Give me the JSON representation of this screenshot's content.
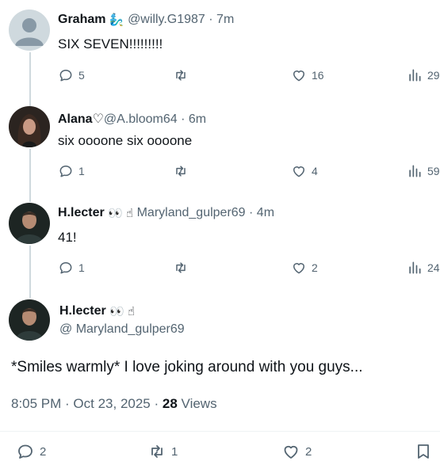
{
  "posts": [
    {
      "name": "Graham",
      "name_emoji": "🧞‍♂️",
      "handle": "@willy.G1987",
      "time": "· 7m",
      "text": "SIX SEVEN!!!!!!!!!",
      "replies": "5",
      "reposts": "",
      "likes": "16",
      "views": "29"
    },
    {
      "name": "Alana♡",
      "name_emoji": "",
      "handle": "@A.bloom64",
      "time": "· 6m",
      "text": "six oooone six oooone",
      "replies": "1",
      "reposts": "",
      "likes": "4",
      "views": "59"
    },
    {
      "name": "H.lecter",
      "name_emoji": "👀 ☝",
      "handle": "Maryland_gulper69",
      "time": "· 4m",
      "text": "41!",
      "replies": "1",
      "reposts": "",
      "likes": "2",
      "views": "24"
    }
  ],
  "main_post": {
    "name": "H.lecter",
    "name_emoji": "👀 ☝",
    "handle": "@ Maryland_gulper69",
    "text": "*Smiles warmly* I love joking around with you guys...",
    "time": "8:05 PM · Oct 23, 2025 ·",
    "views_count": "28",
    "views_label": "Views",
    "replies": "2",
    "reposts": "1",
    "likes": "2"
  },
  "colors": {
    "text": "#0f1419",
    "secondary": "#536471",
    "thread_line": "#cfd9de"
  }
}
